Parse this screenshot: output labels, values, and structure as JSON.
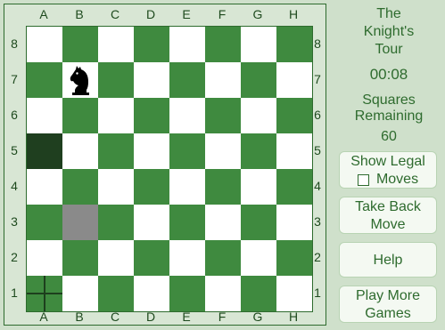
{
  "board": {
    "files": [
      "A",
      "B",
      "C",
      "D",
      "E",
      "F",
      "G",
      "H"
    ],
    "ranks": [
      "8",
      "7",
      "6",
      "5",
      "4",
      "3",
      "2",
      "1"
    ],
    "knight_square": "B7",
    "visited_squares": [
      "A5"
    ],
    "legal_move_squares": [
      "B3"
    ],
    "cursor_square": "A1"
  },
  "panel": {
    "title_line1": "The",
    "title_line2": "Knight's",
    "title_line3": "Tour",
    "timer": "00:08",
    "remaining_line1": "Squares",
    "remaining_line2": "Remaining",
    "remaining_value": "60"
  },
  "buttons": {
    "show_legal_line1": "Show Legal",
    "show_legal_line2": "Moves",
    "take_back_line1": "Take Back",
    "take_back_line2": "Move",
    "help": "Help",
    "play_more_line1": "Play More",
    "play_more_line2": "Games"
  },
  "colors": {
    "dark_square": "#3f8a3f",
    "light_square": "#ffffff",
    "visited_square": "#1f3f1f",
    "legal_square": "#8a8a8a",
    "text": "#2e6b2e"
  },
  "icons": {
    "knight": "chess-knight-icon",
    "cursor": "crosshair-icon"
  }
}
